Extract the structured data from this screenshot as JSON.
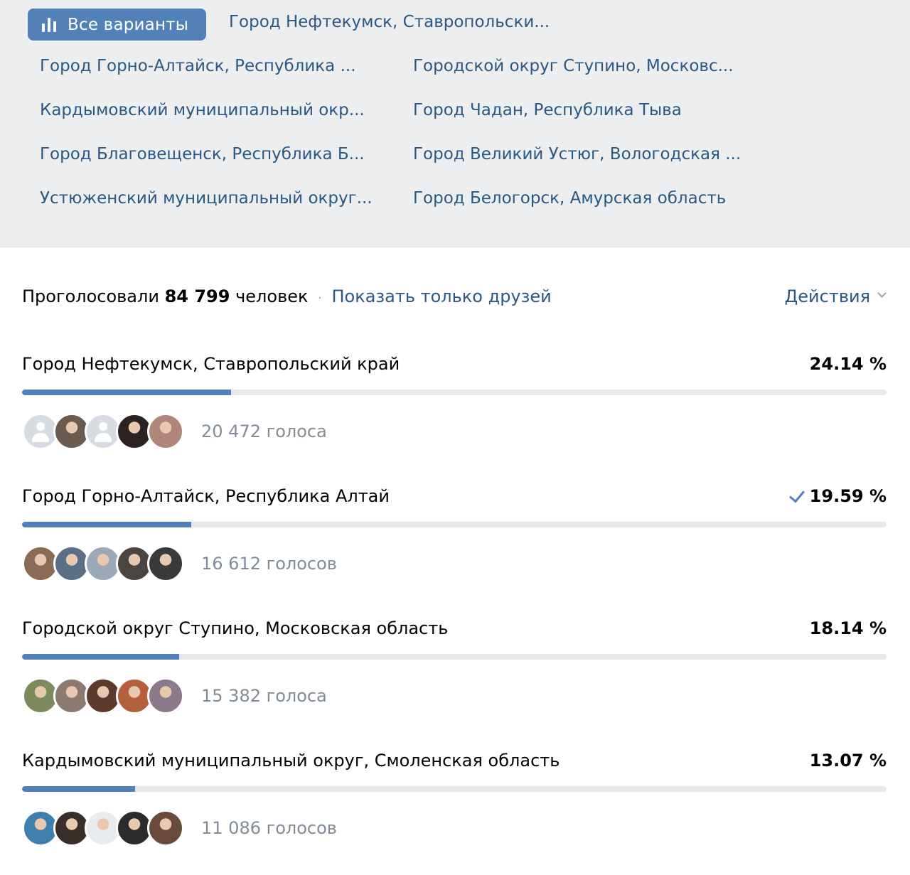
{
  "variants": {
    "all_label": "Все варианты",
    "links": [
      "Город Нефтекумск, Ставропольски...",
      "Город Горно-Алтайск, Республика ...",
      "Городской округ Ступино, Московс...",
      "Кардымовский муниципальный окр...",
      "Город Чадан, Республика Тыва",
      "Город Благовещенск, Республика Б...",
      "Город Великий Устюг, Вологодская ...",
      "Устюженский муниципальный округ...",
      "Город Белогорск, Амурская область"
    ]
  },
  "summary": {
    "prefix": "Проголосовали",
    "count": "84 799",
    "suffix": "человек",
    "separator": "·",
    "friends_link": "Показать только друзей",
    "actions_label": "Действия"
  },
  "options": [
    {
      "title": "Город Нефтекумск, Ставропольский край",
      "percent_label": "24.14 %",
      "percent": 24.14,
      "voted": false,
      "votes": "20 472 голоса",
      "avatars": [
        "placeholder",
        "#6b5a4e",
        "placeholder",
        "#2b2320",
        "#b0857a"
      ]
    },
    {
      "title": "Город Горно-Алтайск, Республика Алтай",
      "percent_label": "19.59 %",
      "percent": 19.59,
      "voted": true,
      "votes": "16 612 голосов",
      "avatars": [
        "#8a6b55",
        "#5a6f86",
        "#9aa8b8",
        "#4a4540",
        "#3a3a3a"
      ]
    },
    {
      "title": "Городской округ Ступино, Московская область",
      "percent_label": "18.14 %",
      "percent": 18.14,
      "voted": false,
      "votes": "15 382 голоса",
      "avatars": [
        "#7d8a5c",
        "#8c7a70",
        "#5c3a2c",
        "#b5603d",
        "#8a7a8c"
      ]
    },
    {
      "title": "Кардымовский муниципальный округ, Смоленская область",
      "percent_label": "13.07 %",
      "percent": 13.07,
      "voted": false,
      "votes": "11 086 голосов",
      "avatars": [
        "#3f7fae",
        "#3a2e2a",
        "#e9ecef",
        "#2c2a2b",
        "#6a4a3c"
      ]
    }
  ]
}
